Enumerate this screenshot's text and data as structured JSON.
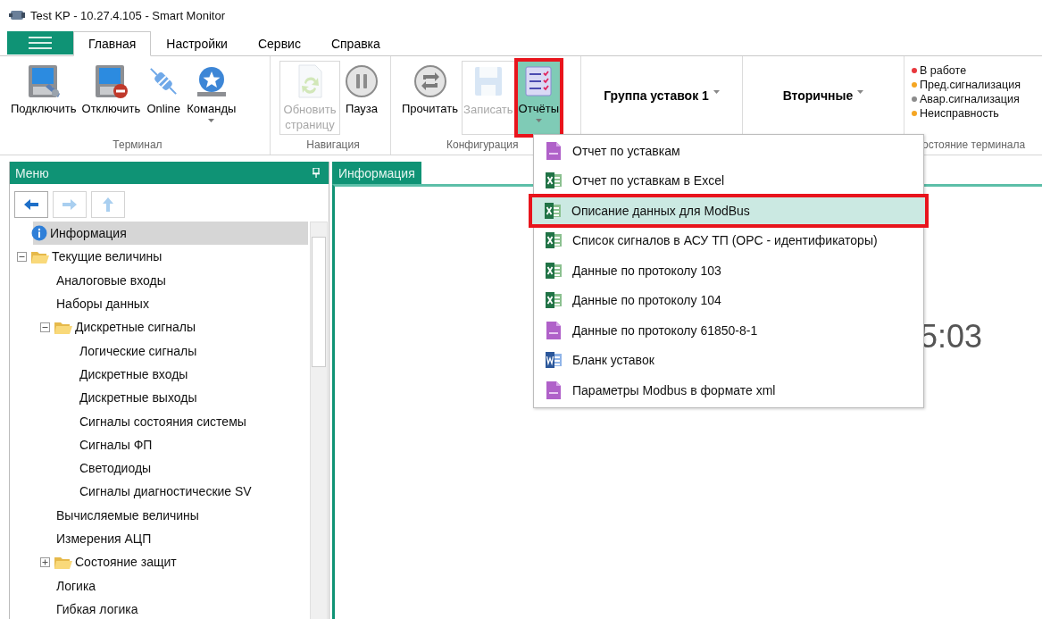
{
  "window": {
    "title": "Test KP - 10.27.4.105 - Smart Monitor"
  },
  "tabs": [
    {
      "label": "Главная",
      "selected": true
    },
    {
      "label": "Настройки",
      "selected": false
    },
    {
      "label": "Сервис",
      "selected": false
    },
    {
      "label": "Справка",
      "selected": false
    }
  ],
  "ribbon": {
    "groups": [
      {
        "label": "Терминал",
        "buttons": [
          {
            "label": "Подключить",
            "disabled": false,
            "dropdown": false,
            "pressed": false,
            "highlighted": false
          },
          {
            "label": "Отключить",
            "disabled": false,
            "dropdown": false,
            "pressed": false,
            "highlighted": false
          },
          {
            "label": "Online",
            "disabled": false,
            "dropdown": false,
            "pressed": false,
            "highlighted": false
          },
          {
            "label": "Команды",
            "disabled": false,
            "dropdown": true,
            "pressed": false,
            "highlighted": false
          }
        ]
      },
      {
        "label": "Навигация",
        "buttons": [
          {
            "label": "Обновить страницу",
            "disabled": true,
            "dropdown": false,
            "pressed": false,
            "highlighted": false
          },
          {
            "label": "Пауза",
            "disabled": false,
            "dropdown": false,
            "pressed": false,
            "highlighted": false
          }
        ]
      },
      {
        "label": "Конфигурация",
        "buttons": [
          {
            "label": "Прочитать",
            "disabled": false,
            "dropdown": false,
            "pressed": false,
            "highlighted": false
          },
          {
            "label": "Записать",
            "disabled": true,
            "dropdown": false,
            "pressed": false,
            "highlighted": false
          },
          {
            "label": "Отчёты",
            "disabled": false,
            "dropdown": true,
            "pressed": true,
            "highlighted": true
          }
        ]
      }
    ],
    "selectors": [
      {
        "label": "Группа уставок 1"
      },
      {
        "label": "Вторичные"
      }
    ],
    "status": {
      "label": "остояние терминала",
      "items": [
        {
          "label": "В работе",
          "color": "#e8383d"
        },
        {
          "label": "Пред.сигнализация",
          "color": "#f5a623"
        },
        {
          "label": "Авар.сигнализация",
          "color": "#8c8c8c"
        },
        {
          "label": "Неисправность",
          "color": "#f5a623"
        }
      ]
    }
  },
  "menu_panel": {
    "title": "Меню",
    "nav_buttons": [
      {
        "disabled": false
      },
      {
        "disabled": true
      },
      {
        "disabled": true
      }
    ],
    "tree": [
      {
        "label": "Информация",
        "kind": "info",
        "selected": true
      },
      {
        "label": "Текущие величины",
        "kind": "folder",
        "selected": false,
        "expanded": true,
        "children": [
          {
            "label": "Аналоговые входы",
            "kind": "leaf",
            "selected": false
          },
          {
            "label": "Наборы данных",
            "kind": "leaf",
            "selected": false
          },
          {
            "label": "Дискретные сигналы",
            "kind": "folder",
            "selected": false,
            "expanded": true,
            "children": [
              {
                "label": "Логические сигналы",
                "kind": "leaf",
                "selected": false
              },
              {
                "label": "Дискретные входы",
                "kind": "leaf",
                "selected": false
              },
              {
                "label": "Дискретные выходы",
                "kind": "leaf",
                "selected": false
              },
              {
                "label": "Сигналы состояния системы",
                "kind": "leaf",
                "selected": false
              },
              {
                "label": "Сигналы ФП",
                "kind": "leaf",
                "selected": false
              },
              {
                "label": "Светодиоды",
                "kind": "leaf",
                "selected": false
              },
              {
                "label": "Сигналы диагностические SV",
                "kind": "leaf",
                "selected": false
              }
            ]
          },
          {
            "label": "Вычисляемые величины",
            "kind": "leaf",
            "selected": false
          },
          {
            "label": "Измерения АЦП",
            "kind": "leaf",
            "selected": false
          },
          {
            "label": "Состояние защит",
            "kind": "folder",
            "selected": false,
            "expanded": false
          },
          {
            "label": "Логика",
            "kind": "leaf",
            "selected": false
          },
          {
            "label": "Гибкая логика",
            "kind": "leaf",
            "selected": false
          }
        ]
      }
    ]
  },
  "document_tabs": [
    {
      "label": "Информация",
      "selected": true
    }
  ],
  "content": {
    "time_fragment": "5:03"
  },
  "reports_menu": {
    "items": [
      {
        "label": "Отчет по уставкам",
        "kind": "txt",
        "selected": false,
        "highlighted": false
      },
      {
        "label": "Отчет по уставкам в Excel",
        "kind": "excel",
        "selected": false,
        "highlighted": false
      },
      {
        "label": "Описание данных для ModBus",
        "kind": "excel",
        "selected": true,
        "highlighted": true
      },
      {
        "label": "Список сигналов в АСУ ТП (OPC - идентификаторы)",
        "kind": "excel",
        "selected": false,
        "highlighted": false
      },
      {
        "label": "Данные по протоколу 103",
        "kind": "excel",
        "selected": false,
        "highlighted": false
      },
      {
        "label": "Данные по протоколу 104",
        "kind": "excel",
        "selected": false,
        "highlighted": false
      },
      {
        "label": "Данные по протоколу 61850-8-1",
        "kind": "txt",
        "selected": false,
        "highlighted": false
      },
      {
        "label": "Бланк уставок",
        "kind": "word",
        "selected": false,
        "highlighted": false
      },
      {
        "label": "Параметры Modbus в формате xml",
        "kind": "txt",
        "selected": false,
        "highlighted": false
      }
    ]
  }
}
